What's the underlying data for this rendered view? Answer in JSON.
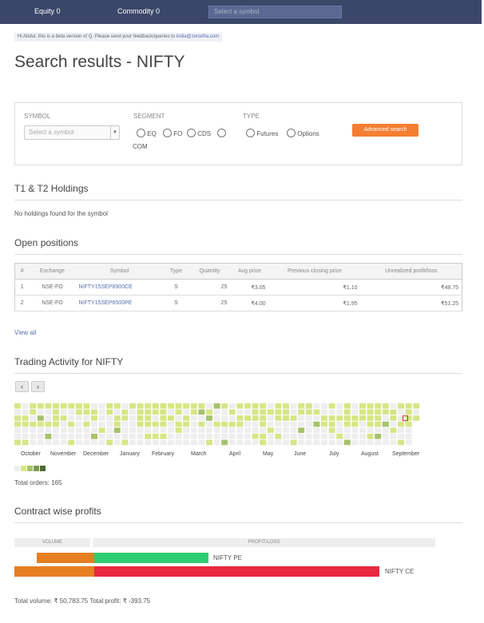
{
  "topnav": {
    "equity_label": "Equity 0",
    "commodity_label": "Commodity 0",
    "search_placeholder": "Select a symbol"
  },
  "beta_note": {
    "text": "Hi Abdul, this is a beta version of Q. Please send your feedback/queries to",
    "email": "india@zerodha.com"
  },
  "page_title": "Search results - NIFTY",
  "search_panel": {
    "symbol_label": "SYMBOL",
    "symbol_placeholder": "Select a symbol",
    "segment_label": "SEGMENT",
    "segment_options": [
      "EQ",
      "FO",
      "CDS",
      "COM"
    ],
    "type_label": "TYPE",
    "type_options": [
      "Futures",
      "Options"
    ],
    "advanced_search_label": "Advanced search"
  },
  "holdings": {
    "title": "T1 & T2 Holdings",
    "empty_text": "No holdings found for the symbol"
  },
  "open_positions": {
    "title": "Open positions",
    "columns": [
      "#",
      "Exchange",
      "Symbol",
      "Type",
      "Quantity",
      "Avg price",
      "Previous closing price",
      "Unrealized profit/loss"
    ],
    "rows": [
      [
        "1",
        "NSE-FO",
        "NIFTY15SEP8900CE",
        "S",
        "25",
        "₹3.05",
        "₹1.10",
        "₹48.75"
      ],
      [
        "2",
        "NSE-FO",
        "NIFTY15SEP6500PE",
        "S",
        "25",
        "₹4.00",
        "₹1.95",
        "₹51.25"
      ]
    ],
    "view_all_label": "View all"
  },
  "trading_activity": {
    "title": "Trading Activity for NIFTY",
    "prev_icon": "chevron-left-icon",
    "next_icon": "chevron-right-icon",
    "months": [
      "October",
      "November",
      "December",
      "January",
      "February",
      "March",
      "April",
      "May",
      "June",
      "July",
      "August",
      "September"
    ],
    "colors": {
      "empty": "#eeeeee",
      "level1": "#d6e685",
      "level2": "#a8c26a",
      "level3": "#7b9a4e",
      "level4": "#4e6b32",
      "today_border": "#c0392b"
    },
    "total_orders_text": "Total orders: 165"
  },
  "contract_profits": {
    "title": "Contract wise profits",
    "volume_header": "VOLUME",
    "pl_header": "PROFIT/LOSS",
    "contracts": [
      {
        "name": "NIFTY PE",
        "volume_color": "#e67e22",
        "pl_color": "#2ecc71"
      },
      {
        "name": "NIFTY CE",
        "volume_color": "#e67e22",
        "pl_color": "#e8293e"
      }
    ],
    "totals_text": "Total volume: ₹ 50,783.75 Total profit: ₹ -393.75"
  }
}
